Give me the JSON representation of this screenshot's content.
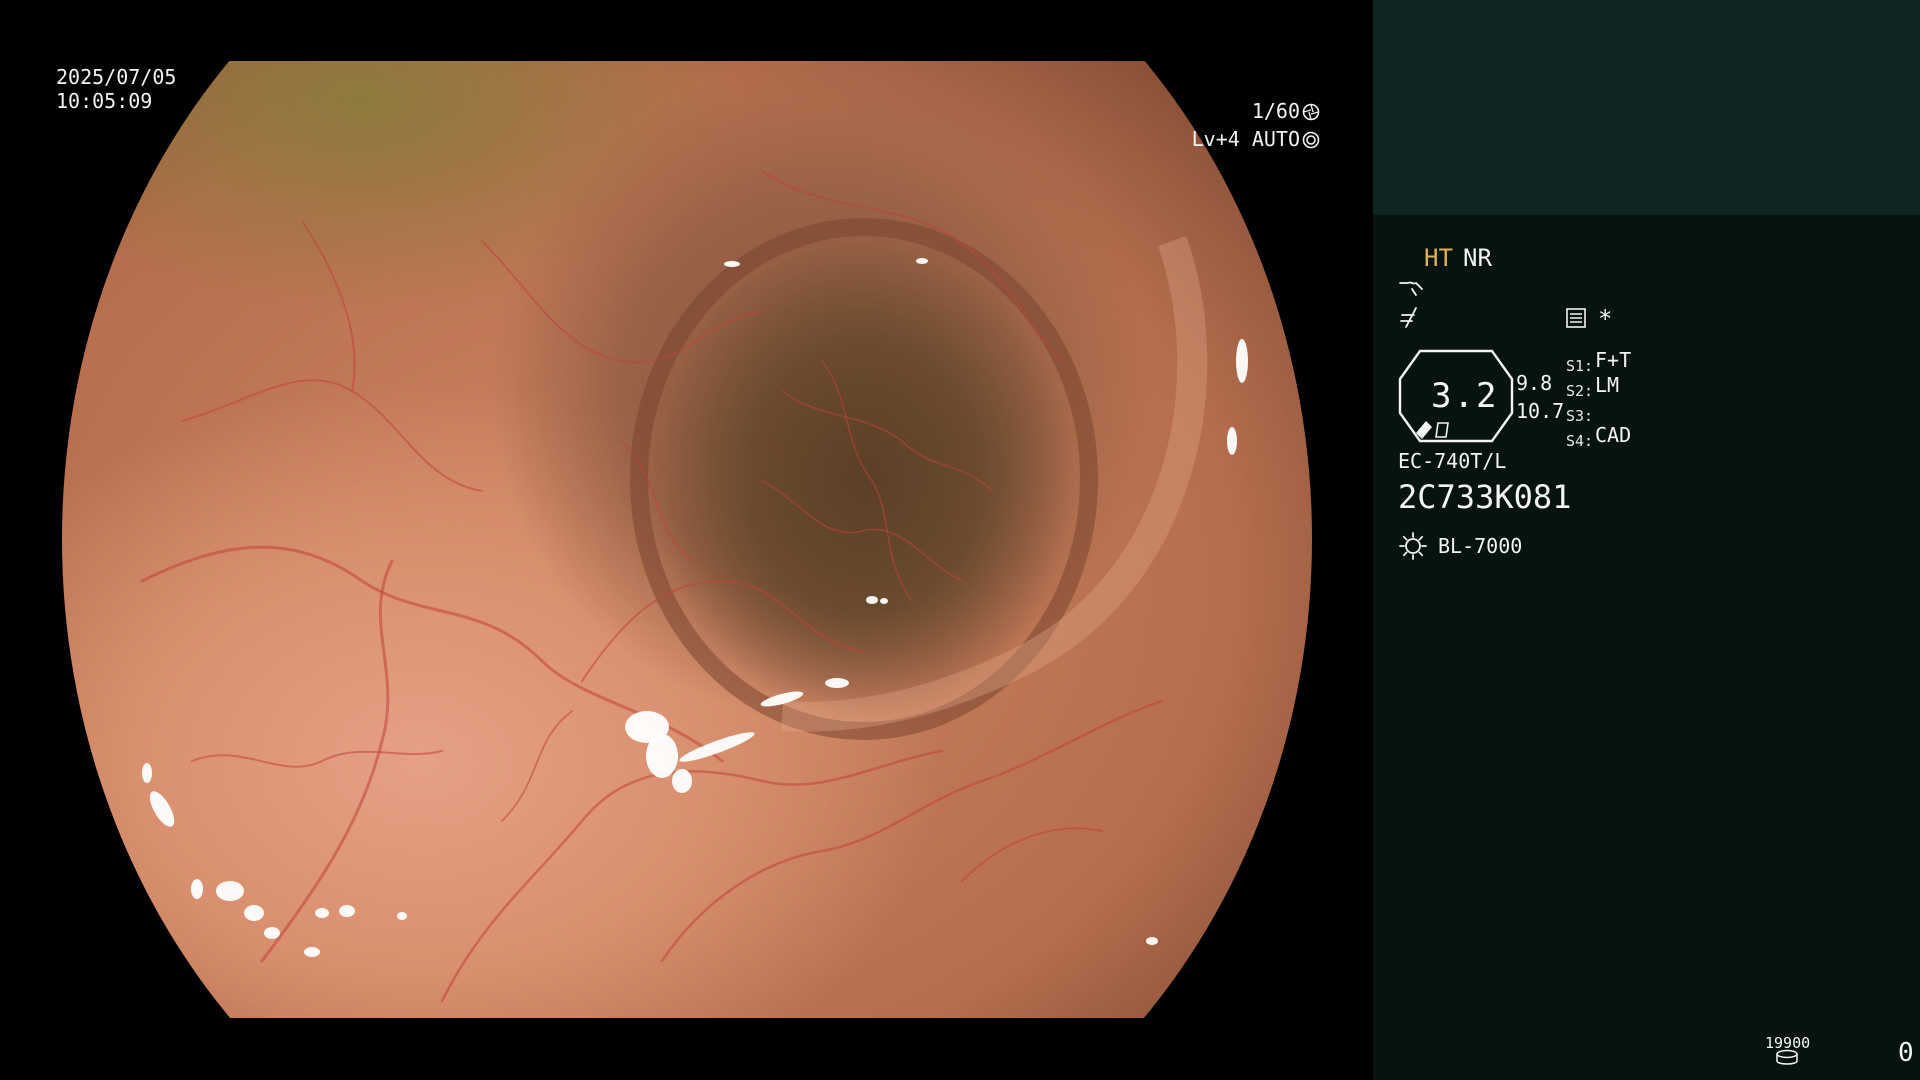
{
  "view": {
    "date": "2025/07/05",
    "time": "10:05:09",
    "shutter": "1/60",
    "shutter_icon": "aperture-icon",
    "level": "Lv+4 AUTO",
    "level_icon": "auto-iris-icon"
  },
  "panel": {
    "mode_ht": "HT",
    "mode_nr": "NR",
    "ht_color": "#e3b34a",
    "icons": [
      "enhance-wave-icon",
      "structure-filter-icon",
      "report-icon"
    ],
    "asterisk": "*",
    "gauge_value": "3.2",
    "value_1": "9.8",
    "value_2": "10.7",
    "switches": [
      {
        "label": "S1:",
        "value": "F+T"
      },
      {
        "label": "S2:",
        "value": "LM"
      },
      {
        "label": "S3:",
        "value": ""
      },
      {
        "label": "S4:",
        "value": "CAD"
      }
    ],
    "scope_model": "EC-740T/L",
    "scope_serial": "2C733K081",
    "light_icon": "light-source-icon",
    "light_source": "BL-7000",
    "counter": "19900",
    "counter_icon": "disk-icon",
    "image_count": "0",
    "top_panel_color": "#0e2522",
    "panel_color": "#061310"
  }
}
